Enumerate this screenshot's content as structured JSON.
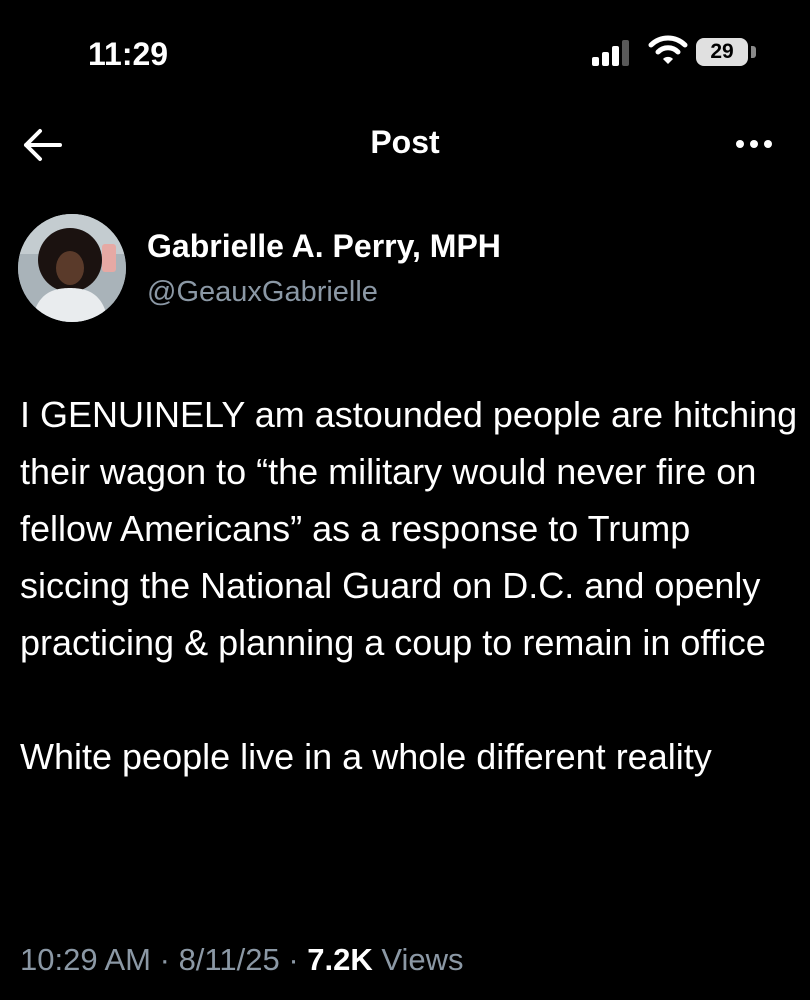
{
  "status_bar": {
    "time": "11:29",
    "battery": "29",
    "icons": [
      "signal-bars-icon",
      "wifi-icon",
      "battery-icon"
    ]
  },
  "nav": {
    "title": "Post",
    "back_icon": "arrow-left-icon",
    "more_icon": "ellipsis-icon"
  },
  "author": {
    "display_name": "Gabrielle A. Perry, MPH",
    "handle": "@GeauxGabrielle"
  },
  "post": {
    "paragraphs": [
      "I GENUINELY am astounded people are hitching their wagon to “the military would never fire on fellow Americans” as a response to Trump siccing the National Guard on D.C. and openly practicing & planning a coup to remain in office",
      "White people live in a whole different reality"
    ],
    "time": "10:29 AM",
    "separator": "·",
    "date": "8/11/25",
    "views_count": "7.2K",
    "views_label": "Views"
  },
  "colors": {
    "background": "#000000",
    "text_primary": "#ffffff",
    "text_secondary": "#8b98a5"
  }
}
